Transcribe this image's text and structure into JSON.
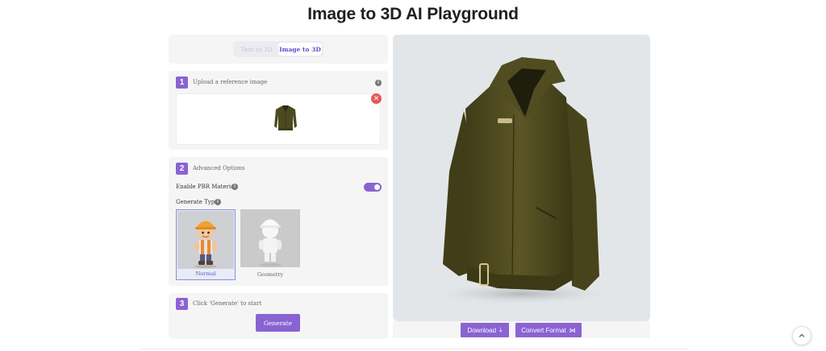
{
  "page": {
    "title": "Image to 3D AI Playground"
  },
  "tabs": [
    {
      "label": "Text to 3D",
      "active": false
    },
    {
      "label": "Image to 3D",
      "active": true
    }
  ],
  "step1": {
    "number": "1",
    "label": "Upload a reference image"
  },
  "step2": {
    "number": "2",
    "label": "Advanced Options",
    "pbr_label": "Enable PBR Material",
    "pbr_enabled": true,
    "generate_type_label": "Generate Type",
    "types": [
      {
        "label": "Normal",
        "selected": true
      },
      {
        "label": "Geometry",
        "selected": false
      }
    ]
  },
  "step3": {
    "number": "3",
    "label": "Click 'Generate' to start",
    "button": "Generate"
  },
  "viewer": {
    "download_label": "Download",
    "convert_label": "Convert Format"
  },
  "colors": {
    "accent": "#8a63d2",
    "remove": "#e45757",
    "viewer_bg": "#e3e6e8",
    "jacket": "#4d4a1f"
  },
  "icons": {
    "info": "info-icon",
    "remove": "close-icon",
    "download": "download-icon",
    "convert": "convert-icon",
    "scroll": "chevron-up-icon"
  }
}
